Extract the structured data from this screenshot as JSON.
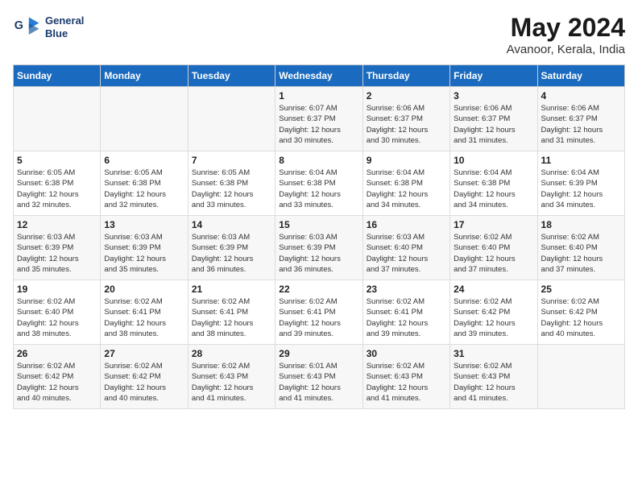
{
  "header": {
    "logo_line1": "General",
    "logo_line2": "Blue",
    "title": "May 2024",
    "subtitle": "Avanoor, Kerala, India"
  },
  "weekdays": [
    "Sunday",
    "Monday",
    "Tuesday",
    "Wednesday",
    "Thursday",
    "Friday",
    "Saturday"
  ],
  "weeks": [
    [
      {
        "day": "",
        "info": ""
      },
      {
        "day": "",
        "info": ""
      },
      {
        "day": "",
        "info": ""
      },
      {
        "day": "1",
        "info": "Sunrise: 6:07 AM\nSunset: 6:37 PM\nDaylight: 12 hours\nand 30 minutes."
      },
      {
        "day": "2",
        "info": "Sunrise: 6:06 AM\nSunset: 6:37 PM\nDaylight: 12 hours\nand 30 minutes."
      },
      {
        "day": "3",
        "info": "Sunrise: 6:06 AM\nSunset: 6:37 PM\nDaylight: 12 hours\nand 31 minutes."
      },
      {
        "day": "4",
        "info": "Sunrise: 6:06 AM\nSunset: 6:37 PM\nDaylight: 12 hours\nand 31 minutes."
      }
    ],
    [
      {
        "day": "5",
        "info": "Sunrise: 6:05 AM\nSunset: 6:38 PM\nDaylight: 12 hours\nand 32 minutes."
      },
      {
        "day": "6",
        "info": "Sunrise: 6:05 AM\nSunset: 6:38 PM\nDaylight: 12 hours\nand 32 minutes."
      },
      {
        "day": "7",
        "info": "Sunrise: 6:05 AM\nSunset: 6:38 PM\nDaylight: 12 hours\nand 33 minutes."
      },
      {
        "day": "8",
        "info": "Sunrise: 6:04 AM\nSunset: 6:38 PM\nDaylight: 12 hours\nand 33 minutes."
      },
      {
        "day": "9",
        "info": "Sunrise: 6:04 AM\nSunset: 6:38 PM\nDaylight: 12 hours\nand 34 minutes."
      },
      {
        "day": "10",
        "info": "Sunrise: 6:04 AM\nSunset: 6:38 PM\nDaylight: 12 hours\nand 34 minutes."
      },
      {
        "day": "11",
        "info": "Sunrise: 6:04 AM\nSunset: 6:39 PM\nDaylight: 12 hours\nand 34 minutes."
      }
    ],
    [
      {
        "day": "12",
        "info": "Sunrise: 6:03 AM\nSunset: 6:39 PM\nDaylight: 12 hours\nand 35 minutes."
      },
      {
        "day": "13",
        "info": "Sunrise: 6:03 AM\nSunset: 6:39 PM\nDaylight: 12 hours\nand 35 minutes."
      },
      {
        "day": "14",
        "info": "Sunrise: 6:03 AM\nSunset: 6:39 PM\nDaylight: 12 hours\nand 36 minutes."
      },
      {
        "day": "15",
        "info": "Sunrise: 6:03 AM\nSunset: 6:39 PM\nDaylight: 12 hours\nand 36 minutes."
      },
      {
        "day": "16",
        "info": "Sunrise: 6:03 AM\nSunset: 6:40 PM\nDaylight: 12 hours\nand 37 minutes."
      },
      {
        "day": "17",
        "info": "Sunrise: 6:02 AM\nSunset: 6:40 PM\nDaylight: 12 hours\nand 37 minutes."
      },
      {
        "day": "18",
        "info": "Sunrise: 6:02 AM\nSunset: 6:40 PM\nDaylight: 12 hours\nand 37 minutes."
      }
    ],
    [
      {
        "day": "19",
        "info": "Sunrise: 6:02 AM\nSunset: 6:40 PM\nDaylight: 12 hours\nand 38 minutes."
      },
      {
        "day": "20",
        "info": "Sunrise: 6:02 AM\nSunset: 6:41 PM\nDaylight: 12 hours\nand 38 minutes."
      },
      {
        "day": "21",
        "info": "Sunrise: 6:02 AM\nSunset: 6:41 PM\nDaylight: 12 hours\nand 38 minutes."
      },
      {
        "day": "22",
        "info": "Sunrise: 6:02 AM\nSunset: 6:41 PM\nDaylight: 12 hours\nand 39 minutes."
      },
      {
        "day": "23",
        "info": "Sunrise: 6:02 AM\nSunset: 6:41 PM\nDaylight: 12 hours\nand 39 minutes."
      },
      {
        "day": "24",
        "info": "Sunrise: 6:02 AM\nSunset: 6:42 PM\nDaylight: 12 hours\nand 39 minutes."
      },
      {
        "day": "25",
        "info": "Sunrise: 6:02 AM\nSunset: 6:42 PM\nDaylight: 12 hours\nand 40 minutes."
      }
    ],
    [
      {
        "day": "26",
        "info": "Sunrise: 6:02 AM\nSunset: 6:42 PM\nDaylight: 12 hours\nand 40 minutes."
      },
      {
        "day": "27",
        "info": "Sunrise: 6:02 AM\nSunset: 6:42 PM\nDaylight: 12 hours\nand 40 minutes."
      },
      {
        "day": "28",
        "info": "Sunrise: 6:02 AM\nSunset: 6:43 PM\nDaylight: 12 hours\nand 41 minutes."
      },
      {
        "day": "29",
        "info": "Sunrise: 6:01 AM\nSunset: 6:43 PM\nDaylight: 12 hours\nand 41 minutes."
      },
      {
        "day": "30",
        "info": "Sunrise: 6:02 AM\nSunset: 6:43 PM\nDaylight: 12 hours\nand 41 minutes."
      },
      {
        "day": "31",
        "info": "Sunrise: 6:02 AM\nSunset: 6:43 PM\nDaylight: 12 hours\nand 41 minutes."
      },
      {
        "day": "",
        "info": ""
      }
    ]
  ]
}
